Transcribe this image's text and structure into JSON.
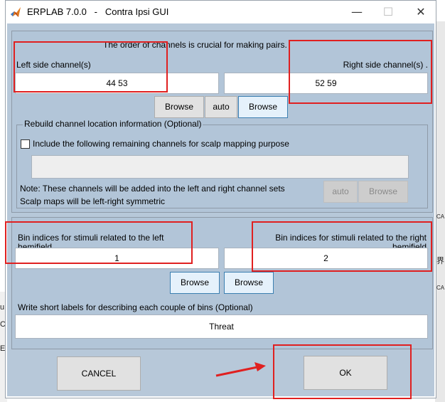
{
  "window": {
    "title": "ERPLAB 7.0.0   -   Contra Ipsi GUI",
    "minimize_glyph": "—",
    "maximize_glyph": "☐",
    "close_glyph": "✕"
  },
  "channels": {
    "order_note": "The order of channels is crucial for making pairs.",
    "left_label": "Left side channel(s)",
    "right_label": "Right side channel(s) .",
    "left_value": "44 53",
    "right_value": "52 59",
    "browse_left": "Browse",
    "auto": "auto",
    "browse_right": "Browse"
  },
  "rebuild": {
    "title": "Rebuild channel location information (Optional)",
    "checkbox_label": "Include the following remaining channels for scalp mapping purpose",
    "remaining_value": "",
    "note_line1": "Note: These channels will be added into the left and right channel sets",
    "note_line2": "Scalp maps will be left-right symmetric",
    "auto": "auto",
    "browse": "Browse"
  },
  "bins": {
    "left_label_line1": "Bin indices for stimuli related to the left",
    "left_label_line2": "hemifield",
    "right_label_line1": "Bin indices for stimuli related to the right",
    "right_label_line2": "hemifield",
    "left_value": "1",
    "right_value": "2",
    "browse_left": "Browse",
    "browse_right": "Browse"
  },
  "labels": {
    "prompt": "Write  short labels for describing each couple of bins (Optional)",
    "value": "Threat"
  },
  "footer": {
    "cancel": "CANCEL",
    "ok": "OK"
  },
  "background": {
    "right_glyph1": "CA",
    "right_glyph2": "界",
    "right_glyph3": "CA",
    "left_glyph1": "u",
    "left_glyph2": "C",
    "left_glyph3": "Ec"
  },
  "colors": {
    "client_bg": "#b7c8d9",
    "annotation_red": "#e02020"
  }
}
